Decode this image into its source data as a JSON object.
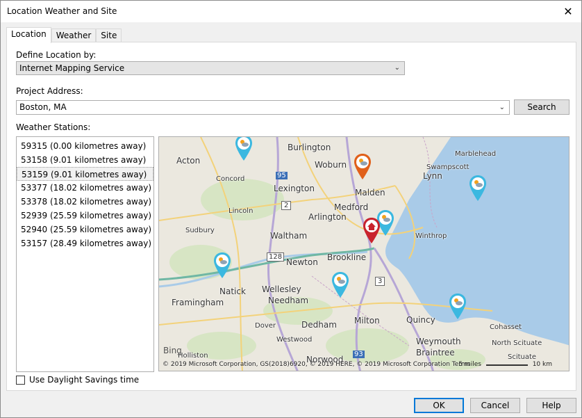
{
  "window": {
    "title": "Location Weather and Site"
  },
  "tabs": [
    {
      "label": "Location",
      "active": true
    },
    {
      "label": "Weather"
    },
    {
      "label": "Site"
    }
  ],
  "define_location": {
    "label": "Define Location by:",
    "selected": "Internet Mapping Service"
  },
  "project_address": {
    "label": "Project Address:",
    "value": "Boston, MA",
    "search_label": "Search"
  },
  "weather_stations": {
    "label": "Weather Stations:",
    "items": [
      "59315 (0.00 kilometres away)",
      "53158 (9.01 kilometres away)",
      "53159 (9.01 kilometres away)",
      "53377 (18.02 kilometres away)",
      "53378 (18.02 kilometres away)",
      "52939 (25.59 kilometres away)",
      "52940 (25.59 kilometres away)",
      "53157 (28.49 kilometres away)"
    ],
    "selected_index": 2
  },
  "map": {
    "labels": [
      "Burlington",
      "Acton",
      "Woburn",
      "Marblehead",
      "Swampscott",
      "Lynn",
      "Concord",
      "Lexington",
      "Malden",
      "Medford",
      "Lincoln",
      "Arlington",
      "Sudbury",
      "Waltham",
      "Winthrop",
      "Newton",
      "Brookline",
      "Natick",
      "Wellesley",
      "Needham",
      "Framingham",
      "Quincy",
      "Cohasset",
      "Dover",
      "Dedham",
      "Milton",
      "Westwood",
      "Weymouth",
      "North Scituate",
      "Braintree",
      "Holliston",
      "Norwood",
      "Scituate"
    ],
    "road_shields": [
      "95",
      "2",
      "128",
      "3",
      "93"
    ],
    "bing": "Bing",
    "copyright": "© 2019 Microsoft Corporation, GS(2018)6920, © 2019 HERE, © 2019 Microsoft Corporation  Terms",
    "scale_miles": "5 miles",
    "scale_km": "10 km"
  },
  "daylight": {
    "label": "Use Daylight Savings time",
    "checked": false
  },
  "buttons": {
    "ok": "OK",
    "cancel": "Cancel",
    "help": "Help"
  },
  "colors": {
    "water": "#a9cbe8",
    "station_pin": "#3bb8e0",
    "active_pin": "#e0601a",
    "home_pin": "#c9232d",
    "accent": "#0078d7"
  }
}
